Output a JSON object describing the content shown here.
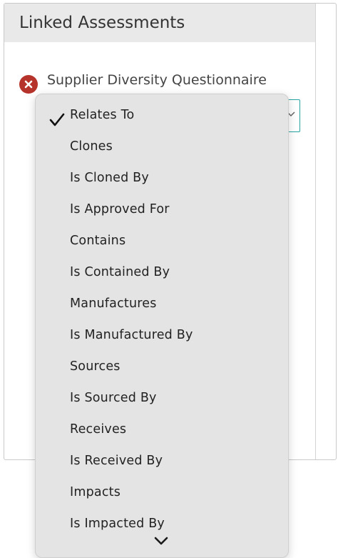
{
  "panel": {
    "title": "Linked Assessments"
  },
  "assessment": {
    "name": "Supplier Diversity Questionnaire",
    "remove_icon": "close-circle-icon",
    "remove_color": "#b5332a"
  },
  "select": {
    "border_color": "#27a4a0",
    "caret_icon": "chevron-down-icon"
  },
  "dropdown": {
    "selected": "Relates To",
    "check_icon": "checkmark-icon",
    "scroll_icon": "chevron-down-icon",
    "items": [
      "Relates To",
      "Clones",
      "Is Cloned By",
      "Is Approved For",
      "Contains",
      "Is Contained By",
      "Manufactures",
      "Is Manufactured By",
      "Sources",
      "Is Sourced By",
      "Receives",
      "Is Received By",
      "Impacts",
      "Is Impacted By"
    ]
  }
}
